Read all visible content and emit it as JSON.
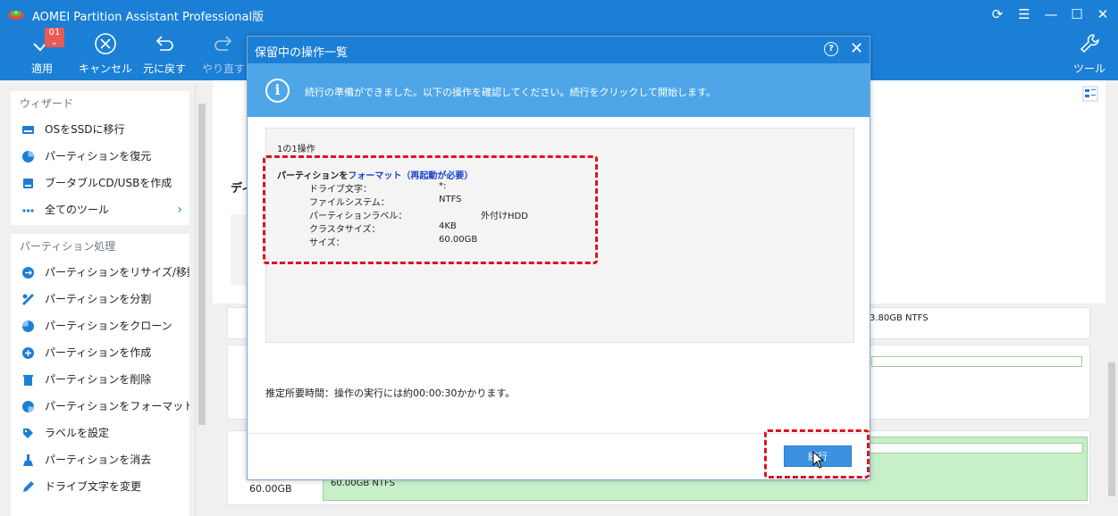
{
  "app": {
    "title": "AOMEI Partition Assistant Professional版",
    "window_controls": [
      "⟳",
      "☰",
      "—",
      "☐",
      "✕"
    ]
  },
  "toolbar": {
    "apply_label": "適用",
    "apply_badge": "01",
    "cancel_label": "キャンセル",
    "undo_label": "元に戻す",
    "redo_label": "やり直す",
    "tools_label": "ツール"
  },
  "sidebar": {
    "wizard_header": "ウィザード",
    "wizard_items": [
      {
        "label": "OSをSSDに移行",
        "icon": "drive-icon"
      },
      {
        "label": "パーティションを復元",
        "icon": "pie-icon"
      },
      {
        "label": "ブータブルCD/USBを作成",
        "icon": "usb-icon"
      },
      {
        "label": "全てのツール",
        "icon": "dots-icon"
      }
    ],
    "partition_header": "パーティション処理",
    "partition_items": [
      {
        "label": "パーティションをリサイズ/移動",
        "icon": "resize-icon"
      },
      {
        "label": "パーティションを分割",
        "icon": "split-icon"
      },
      {
        "label": "パーティションをクローン",
        "icon": "clone-icon"
      },
      {
        "label": "パーティションを作成",
        "icon": "create-icon"
      },
      {
        "label": "パーティションを削除",
        "icon": "trash-icon"
      },
      {
        "label": "パーティションをフォーマット",
        "icon": "format-icon"
      },
      {
        "label": "ラベルを設定",
        "icon": "tag-icon"
      },
      {
        "label": "パーティションを消去",
        "icon": "wipe-icon"
      },
      {
        "label": "ドライブ文字を変更",
        "icon": "pencil-icon"
      }
    ]
  },
  "main": {
    "disk_label_partial": "ディ",
    "disk1_partition": "3.80GB NTFS",
    "disk3_size": "60.00GB",
    "disk3_partition": "60.00GB NTFS"
  },
  "dialog": {
    "title": "保留中の操作一覧",
    "help": "?",
    "close": "✕",
    "info_text": "続行の準備ができました。以下の操作を確認してください。続行をクリックして開始します。",
    "ops_count": "1の1操作",
    "op_title_prefix": "パーティションを",
    "op_title_action": "フォーマット（再起動が必要）",
    "op_details": [
      {
        "key": "ドライブ文字：",
        "value": "*:"
      },
      {
        "key": "ファイルシステム：",
        "value": "NTFS"
      },
      {
        "key": "パーティションラベル：",
        "value": "外付けHDD"
      },
      {
        "key": "クラスタサイズ：",
        "value": "4KB"
      },
      {
        "key": "サイズ：",
        "value": "60.00GB"
      }
    ],
    "estimate": "推定所要時間：操作の実行には約00:00:30かかります。",
    "proceed_label": "続行"
  },
  "colors": {
    "brand_blue": "#1b7fd6",
    "info_blue": "#4ea6e8",
    "highlight_red": "#d9171e",
    "partition_green": "#c8f0c8"
  }
}
